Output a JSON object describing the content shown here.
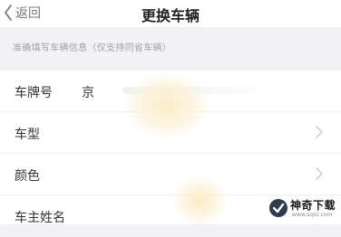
{
  "navbar": {
    "back_label": "返回",
    "title": "更换车辆"
  },
  "hint": "准确填写车辆信息（仅支持同省车辆）",
  "form": {
    "rows": [
      {
        "label": "车牌号",
        "value": "京"
      },
      {
        "label": "车型"
      },
      {
        "label": "颜色"
      },
      {
        "label": "车主姓名"
      }
    ]
  },
  "watermark": {
    "name": "神奇下载",
    "url": "www.sqxz.com"
  },
  "colors": {
    "background": "#f2f2f4",
    "surface": "#ffffff",
    "text": "#333333",
    "hint": "#a0a0a0",
    "chevron": "#c8c8c8"
  }
}
